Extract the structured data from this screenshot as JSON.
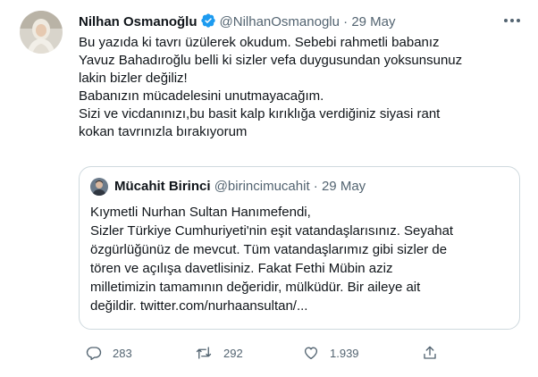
{
  "tweet": {
    "author_name": "Nilhan Osmanoğlu",
    "handle": "@NilhanOsmanoglu",
    "separator": "·",
    "date": "29 May",
    "lines": [
      "Bu yazıda ki tavrı üzülerek okudum. Sebebi rahmetli babanız",
      "Yavuz Bahadıroğlu belli ki sizler vefa duygusundan yoksunsunuz",
      "lakin bizler değiliz!",
      "Babanızın mücadelesini unutmayacağım.",
      "Sizi ve vicdanınızı,bu basit kalp kırıklığa verdiğiniz siyasi rant",
      "kokan tavrınızla bırakıyorum"
    ]
  },
  "quote": {
    "author_name": "Mücahit Birinci",
    "handle": "@birincimucahit",
    "separator": "·",
    "date": "29 May",
    "lines": [
      "Kıymetli Nurhan Sultan Hanımefendi,",
      "Sizler Türkiye Cumhuriyeti'nin eşit vatandaşlarısınız. Seyahat",
      "özgürlüğünüz de mevcut. Tüm vatandaşlarımız gibi sizler de",
      "tören ve açılışa davetlisiniz. Fakat Fethi Mübin aziz",
      "milletimizin tamamının değeridir, mülküdür. Bir aileye ait",
      "değildir. twitter.com/nurhaansultan/..."
    ]
  },
  "actions": {
    "reply_count": "283",
    "retweet_count": "292",
    "like_count": "1.939"
  },
  "colors": {
    "text": "#0f1419",
    "muted": "#536471",
    "verified": "#1d9bf0",
    "border": "#cfd9de"
  }
}
